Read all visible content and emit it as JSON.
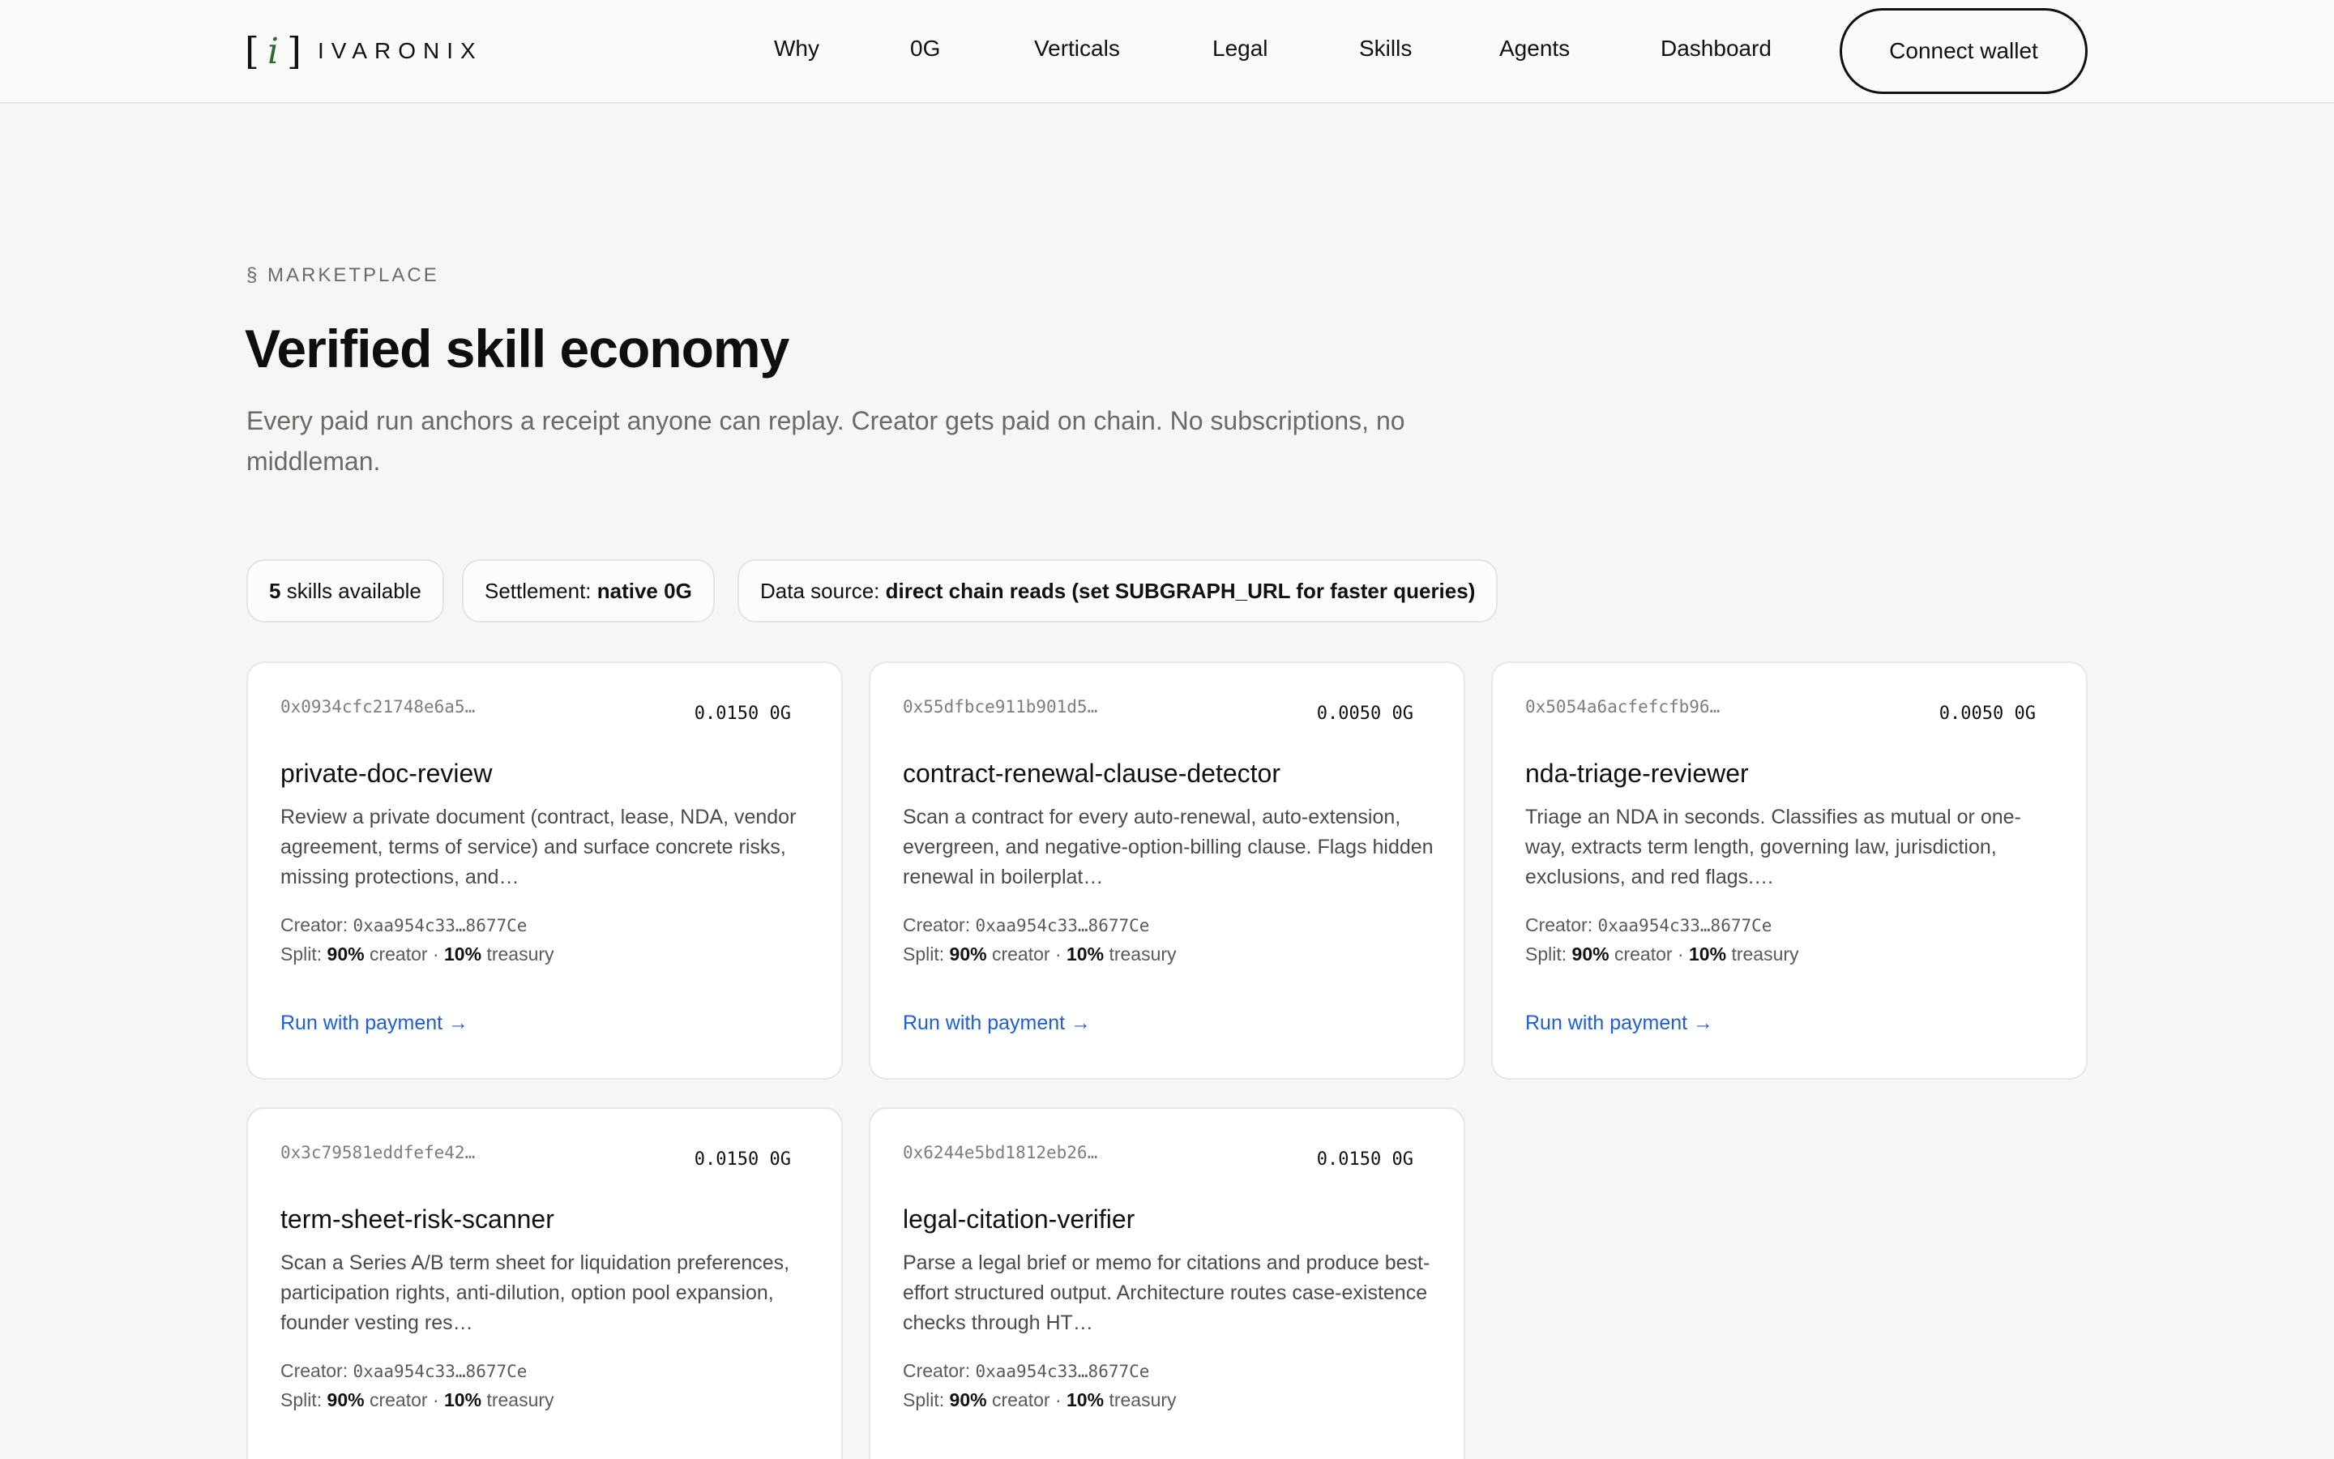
{
  "nav": {
    "logo_text": "IVARONIX",
    "logo_mark_left": "[",
    "logo_mark_i": "i",
    "logo_mark_right": "]",
    "items": [
      "Why",
      "0G",
      "Verticals",
      "Legal",
      "Skills",
      "Agents",
      "Dashboard"
    ],
    "connect_label": "Connect wallet"
  },
  "hero": {
    "eyebrow": "§ MARKETPLACE",
    "title": "Verified skill economy",
    "subtitle": "Every paid run anchors a receipt anyone can replay. Creator gets paid on chain. No subscriptions, no middleman."
  },
  "stats": {
    "skills_count": "5",
    "skills_label": "skills available",
    "settlement_label": "Settlement:",
    "settlement_value": "native 0G",
    "source_label": "Data source:",
    "source_value": "direct chain reads (set SUBGRAPH_URL for faster queries)"
  },
  "card_common": {
    "creator_label": "Creator:",
    "split_label": "Split:",
    "creator_pct": "90%",
    "creator_word": "creator",
    "dot": "·",
    "treasury_pct": "10%",
    "treasury_word": "treasury",
    "run_label": "Run with payment →"
  },
  "skills": [
    {
      "hash": "0x0934cfc21748e6a5…",
      "price": "0.0150 0G",
      "name": "private-doc-review",
      "desc": "Review a private document (contract, lease, NDA, vendor agreement, terms of service) and surface concrete risks, missing protections, and…",
      "creator": "0xaa954c33…8677Ce"
    },
    {
      "hash": "0x55dfbce911b901d5…",
      "price": "0.0050 0G",
      "name": "contract-renewal-clause-detector",
      "desc": "Scan a contract for every auto-renewal, auto-extension, evergreen, and negative-option-billing clause. Flags hidden renewal in boilerplat…",
      "creator": "0xaa954c33…8677Ce"
    },
    {
      "hash": "0x5054a6acfefcfb96…",
      "price": "0.0050 0G",
      "name": "nda-triage-reviewer",
      "desc": "Triage an NDA in seconds. Classifies as mutual or one-way, extracts term length, governing law, jurisdiction, exclusions, and red flags.…",
      "creator": "0xaa954c33…8677Ce"
    },
    {
      "hash": "0x3c79581eddfefe42…",
      "price": "0.0150 0G",
      "name": "term-sheet-risk-scanner",
      "desc": "Scan a Series A/B term sheet for liquidation preferences, participation rights, anti-dilution, option pool expansion, founder vesting res…",
      "creator": "0xaa954c33…8677Ce"
    },
    {
      "hash": "0x6244e5bd1812eb26…",
      "price": "0.0150 0G",
      "name": "legal-citation-verifier",
      "desc": "Parse a legal brief or memo for citations and produce best-effort structured output. Architecture routes case-existence checks through HT…",
      "creator": "0xaa954c33…8677Ce"
    }
  ]
}
